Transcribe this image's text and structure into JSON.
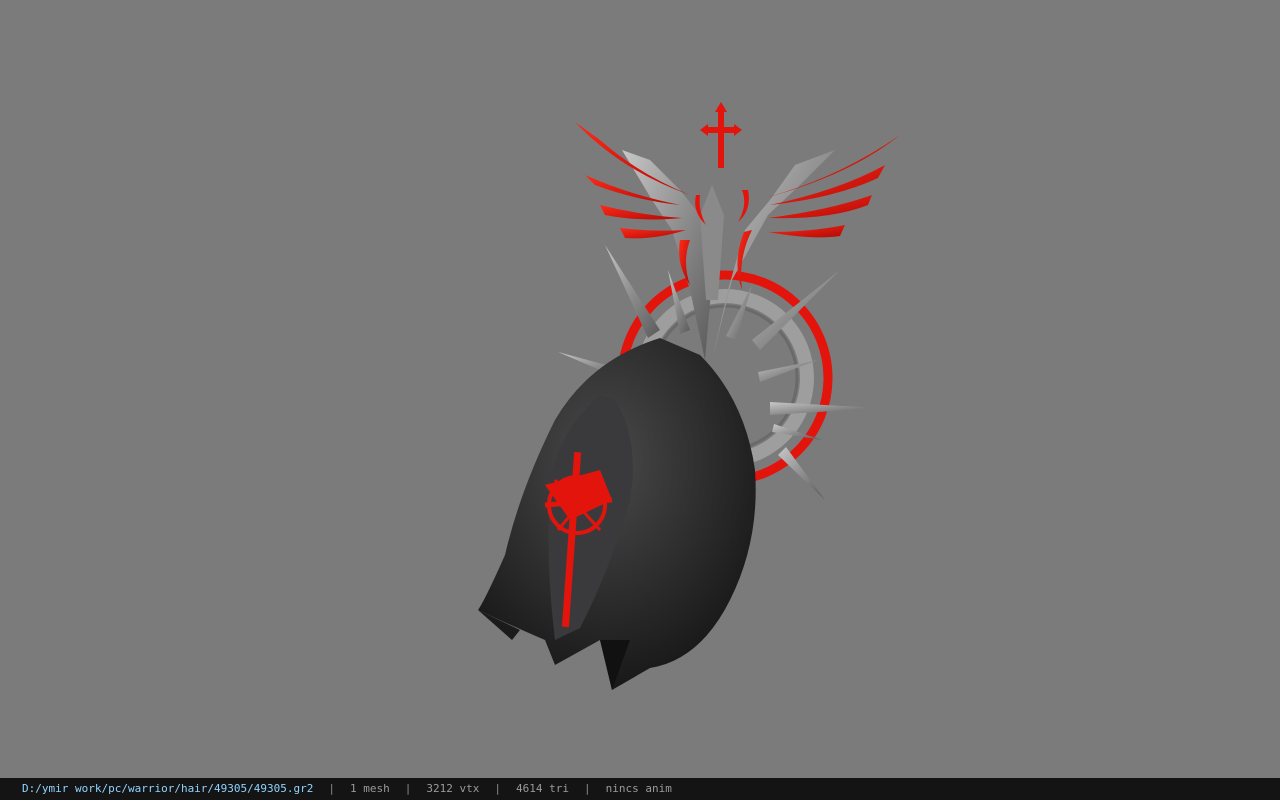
{
  "viewer": {
    "background_color": "#7b7b7b",
    "model_colors": {
      "accent_red": "#e3140c",
      "metal": "#9c9c9c",
      "cloth": "#2b2b2b"
    }
  },
  "status_bar": {
    "file_path": "D:/ymir work/pc/warrior/hair/49305/49305.gr2",
    "separator": "|",
    "mesh_count": "1 mesh",
    "vertex_count": "3212 vtx",
    "triangle_count": "4614 tri",
    "animation": "nincs anim"
  }
}
